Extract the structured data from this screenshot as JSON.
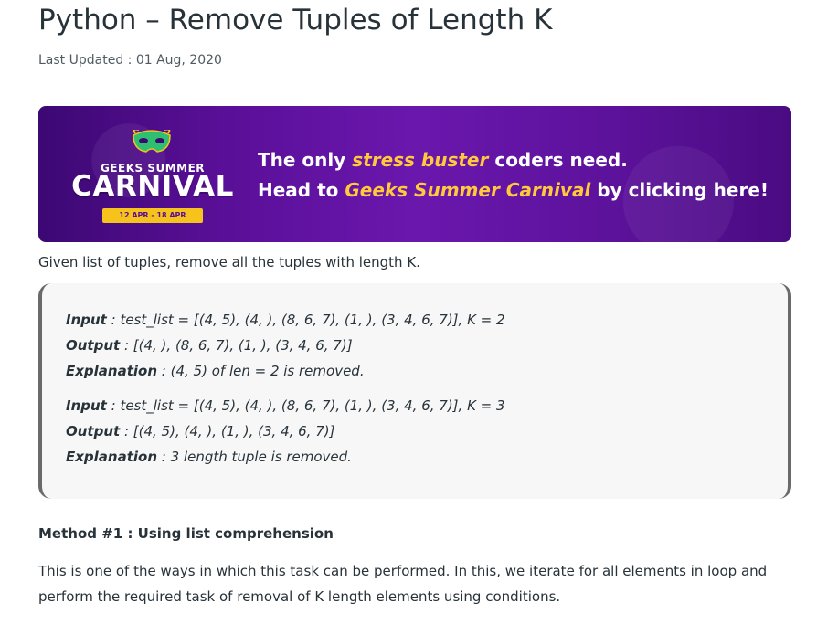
{
  "article": {
    "title": "Python – Remove Tuples of Length K",
    "last_updated": "Last Updated : 01 Aug, 2020"
  },
  "banner": {
    "logo_top": "GEEKS SUMMER",
    "logo_main": "CARNIVAL",
    "logo_dates": "12 APR - 18 APR",
    "line1_pre": "The only ",
    "line1_hl": "stress buster",
    "line1_post": " coders need.",
    "line2_pre": "Head to ",
    "line2_hl": "Geeks Summer Carnival",
    "line2_post": " by clicking here!"
  },
  "intro": "Given list of tuples, remove all the tuples with length K.",
  "examples": [
    {
      "input_label": "Input",
      "input_value": " : test_list = [(4, 5), (4, ), (8, 6, 7), (1, ), (3, 4, 6, 7)], K = 2",
      "output_label": "Output",
      "output_value": " : [(4, ), (8, 6, 7), (1, ), (3, 4, 6, 7)]",
      "explanation_label": "Explanation",
      "explanation_value": " : (4, 5) of len = 2 is removed."
    },
    {
      "input_label": "Input",
      "input_value": " : test_list = [(4, 5), (4, ), (8, 6, 7), (1, ), (3, 4, 6, 7)], K = 3",
      "output_label": "Output",
      "output_value": " : [(4, 5), (4, ), (1, ), (3, 4, 6, 7)]",
      "explanation_label": "Explanation",
      "explanation_value": " : 3 length tuple is removed."
    }
  ],
  "method": {
    "heading": "Method #1 : Using list comprehension",
    "description": "This is one of the ways in which this task can be performed. In this, we iterate for all elements in loop and perform the required task of removal of K length elements using conditions."
  },
  "colors": {
    "text": "#273239",
    "banner_purple": "#5a0f98",
    "banner_highlight": "#ffc83d",
    "example_bg": "#f7f7f7",
    "example_border": "#6a6a6a"
  }
}
